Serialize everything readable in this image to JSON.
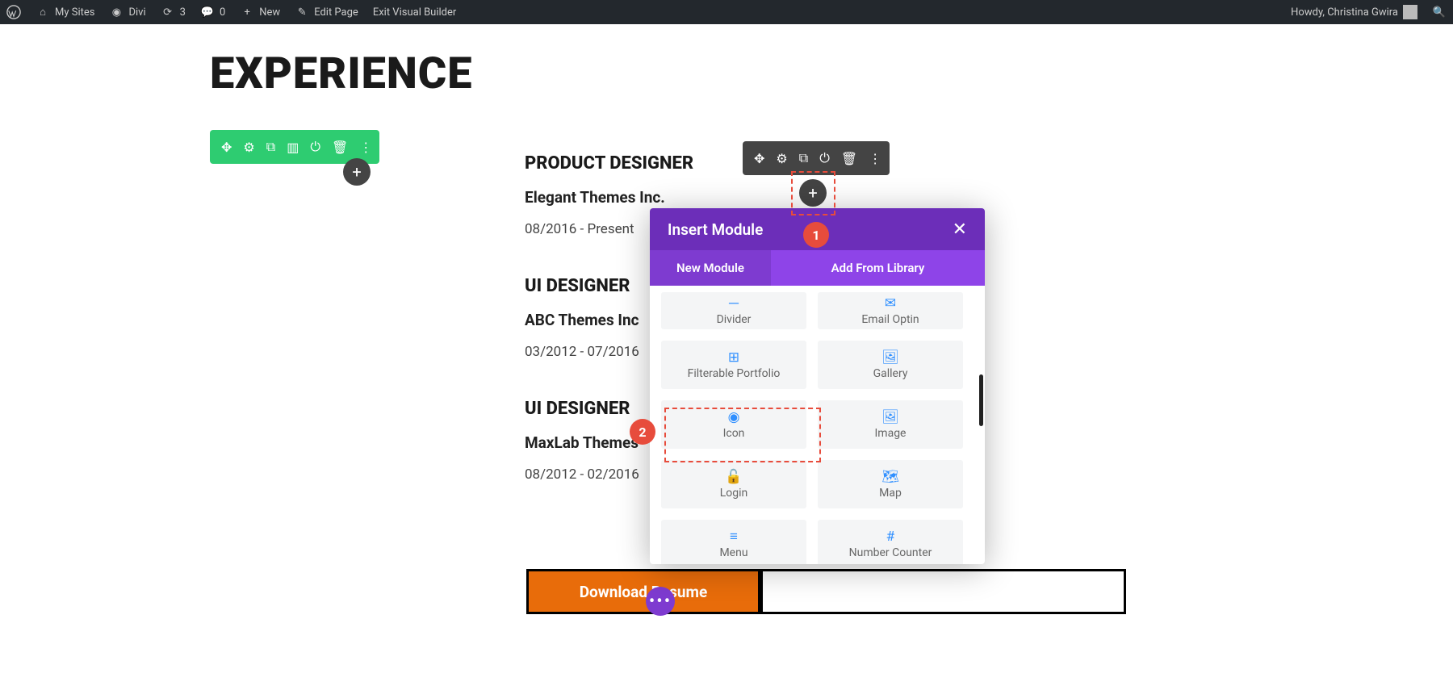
{
  "adminbar": {
    "my_sites": "My Sites",
    "divi": "Divi",
    "updates": "3",
    "comments": "0",
    "new": "New",
    "edit_page": "Edit Page",
    "exit_builder": "Exit Visual Builder",
    "howdy": "Howdy, Christina Gwira"
  },
  "page": {
    "heading": "EXPERIENCE",
    "jobs": [
      {
        "title": "PRODUCT DESIGNER",
        "company": "Elegant Themes Inc.",
        "dates": "08/2016 - Present"
      },
      {
        "title": "UI DESIGNER",
        "company": "ABC Themes Inc",
        "dates": "03/2012 - 07/2016"
      },
      {
        "title": "UI DESIGNER",
        "company": "MaxLab Themes",
        "dates": "08/2012 - 02/2016"
      }
    ],
    "download_label": "Download Resume"
  },
  "modal": {
    "title": "Insert Module",
    "tab_new": "New Module",
    "tab_library": "Add From Library",
    "modules": [
      {
        "icon": "─",
        "label": "Divider"
      },
      {
        "icon": "✉",
        "label": "Email Optin"
      },
      {
        "icon": "⊞",
        "label": "Filterable Portfolio"
      },
      {
        "icon": "🖼",
        "label": "Gallery"
      },
      {
        "icon": "◉",
        "label": "Icon"
      },
      {
        "icon": "🖼",
        "label": "Image"
      },
      {
        "icon": "🔓",
        "label": "Login"
      },
      {
        "icon": "🗺",
        "label": "Map"
      },
      {
        "icon": "≡",
        "label": "Menu"
      },
      {
        "icon": "#",
        "label": "Number Counter"
      }
    ]
  },
  "badges": {
    "one": "1",
    "two": "2"
  }
}
